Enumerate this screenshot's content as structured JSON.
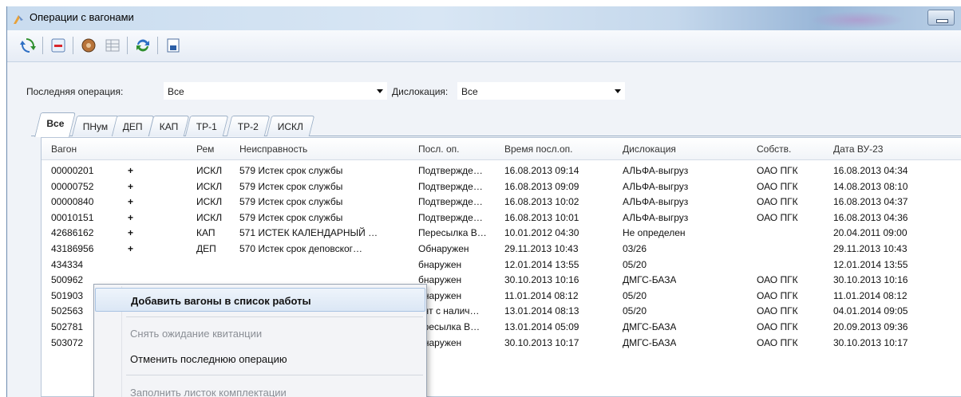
{
  "window": {
    "title": "Операции с вагонами"
  },
  "toolbar": {
    "buttons": [
      {
        "name": "refresh-icon"
      },
      {
        "name": "remove-icon"
      },
      {
        "name": "operation-icon"
      },
      {
        "name": "table-icon"
      },
      {
        "name": "sync-icon"
      },
      {
        "name": "save-icon"
      }
    ]
  },
  "filters": {
    "last_op_label": "Последняя операция:",
    "last_op_value": "Все",
    "location_label": "Дислокация:",
    "location_value": "Все"
  },
  "tabs": [
    "Все",
    "ПНум",
    "ДЕП",
    "КАП",
    "ТР-1",
    "ТР-2",
    "ИСКЛ"
  ],
  "grid": {
    "columns": [
      "Вагон",
      "Рем",
      "Неисправность",
      "Посл. оп.",
      "Время посл.оп.",
      "Дислокация",
      "Собств.",
      "Дата ВУ-23"
    ],
    "rows": [
      {
        "wagon": "00000201",
        "plus": "+",
        "rem": "ИСКЛ",
        "fault": "579 Истек срок службы",
        "op": "Подтвержде…",
        "time": "16.08.2013 09:14",
        "loc": "АЛЬФА-выгруз",
        "owner": "ОАО ПГК",
        "date": "16.08.2013 04:34"
      },
      {
        "wagon": "00000752",
        "plus": "+",
        "rem": "ИСКЛ",
        "fault": "579 Истек срок службы",
        "op": "Подтвержде…",
        "time": "16.08.2013 09:09",
        "loc": "АЛЬФА-выгруз",
        "owner": "ОАО ПГК",
        "date": "14.08.2013 08:10"
      },
      {
        "wagon": "00000840",
        "plus": "+",
        "rem": "ИСКЛ",
        "fault": "579 Истек срок службы",
        "op": "Подтвержде…",
        "time": "16.08.2013 10:02",
        "loc": "АЛЬФА-выгруз",
        "owner": "ОАО ПГК",
        "date": "16.08.2013 04:37"
      },
      {
        "wagon": "00010151",
        "plus": "+",
        "rem": "ИСКЛ",
        "fault": "579 Истек срок службы",
        "op": "Подтвержде…",
        "time": "16.08.2013 10:01",
        "loc": "АЛЬФА-выгруз",
        "owner": "ОАО ПГК",
        "date": "16.08.2013 04:36"
      },
      {
        "wagon": "42686162",
        "plus": "+",
        "rem": "КАП",
        "fault": "571 ИСТЕК КАЛЕНДАРНЫЙ …",
        "op": "Пересылка В…",
        "time": "10.01.2012 04:30",
        "loc": "Не определен",
        "owner": "",
        "date": "20.04.2011 09:00"
      },
      {
        "wagon": "43186956",
        "plus": "+",
        "rem": "ДЕП",
        "fault": "570 Истек срок деповског…",
        "op": "Обнаружен",
        "time": "29.11.2013 10:43",
        "loc": "03/26",
        "owner": "",
        "date": "29.11.2013 10:43"
      },
      {
        "wagon": "434334",
        "plus": "",
        "rem": "",
        "fault": "",
        "op": "бнаружен",
        "time": "12.01.2014 13:55",
        "loc": "05/20",
        "owner": "",
        "date": "12.01.2014 13:55"
      },
      {
        "wagon": "500962",
        "plus": "",
        "rem": "",
        "fault": "",
        "op": "бнаружен",
        "time": "30.10.2013 10:16",
        "loc": "ДМГС-БАЗА",
        "owner": "ОАО ПГК",
        "date": "30.10.2013 10:16"
      },
      {
        "wagon": "501903",
        "plus": "",
        "rem": "",
        "fault": "",
        "op": "бнаружен",
        "time": "11.01.2014 08:12",
        "loc": "05/20",
        "owner": "ОАО ПГК",
        "date": "11.01.2014 08:12"
      },
      {
        "wagon": "502563",
        "plus": "",
        "rem": "",
        "fault": "",
        "op": "нят с налич…",
        "time": "13.01.2014 08:13",
        "loc": "05/20",
        "owner": "ОАО ПГК",
        "date": "04.01.2014 09:05"
      },
      {
        "wagon": "502781",
        "plus": "",
        "rem": "",
        "fault": "",
        "op": "ересылка В…",
        "time": "13.01.2014 05:09",
        "loc": "ДМГС-БАЗА",
        "owner": "ОАО ПГК",
        "date": "20.09.2013 09:36"
      },
      {
        "wagon": "503072",
        "plus": "",
        "rem": "",
        "fault": "",
        "op": "бнаружен",
        "time": "30.10.2013 10:17",
        "loc": "ДМГС-БАЗА",
        "owner": "ОАО ПГК",
        "date": "30.10.2013 10:17"
      }
    ]
  },
  "context_menu": {
    "items": [
      {
        "label": "Добавить вагоны в список работы",
        "state": "highlighted"
      },
      {
        "label": "Снять ожидание квитанции",
        "state": "disabled"
      },
      {
        "label": "Отменить последнюю операцию",
        "state": "normal"
      },
      {
        "label": "Заполнить листок комплектации",
        "state": "disabled"
      }
    ]
  },
  "colors": {
    "plus_green": "#1f9a2e",
    "menu_highlight": "#dbe7f5",
    "title_bar": "#c9dcef"
  }
}
